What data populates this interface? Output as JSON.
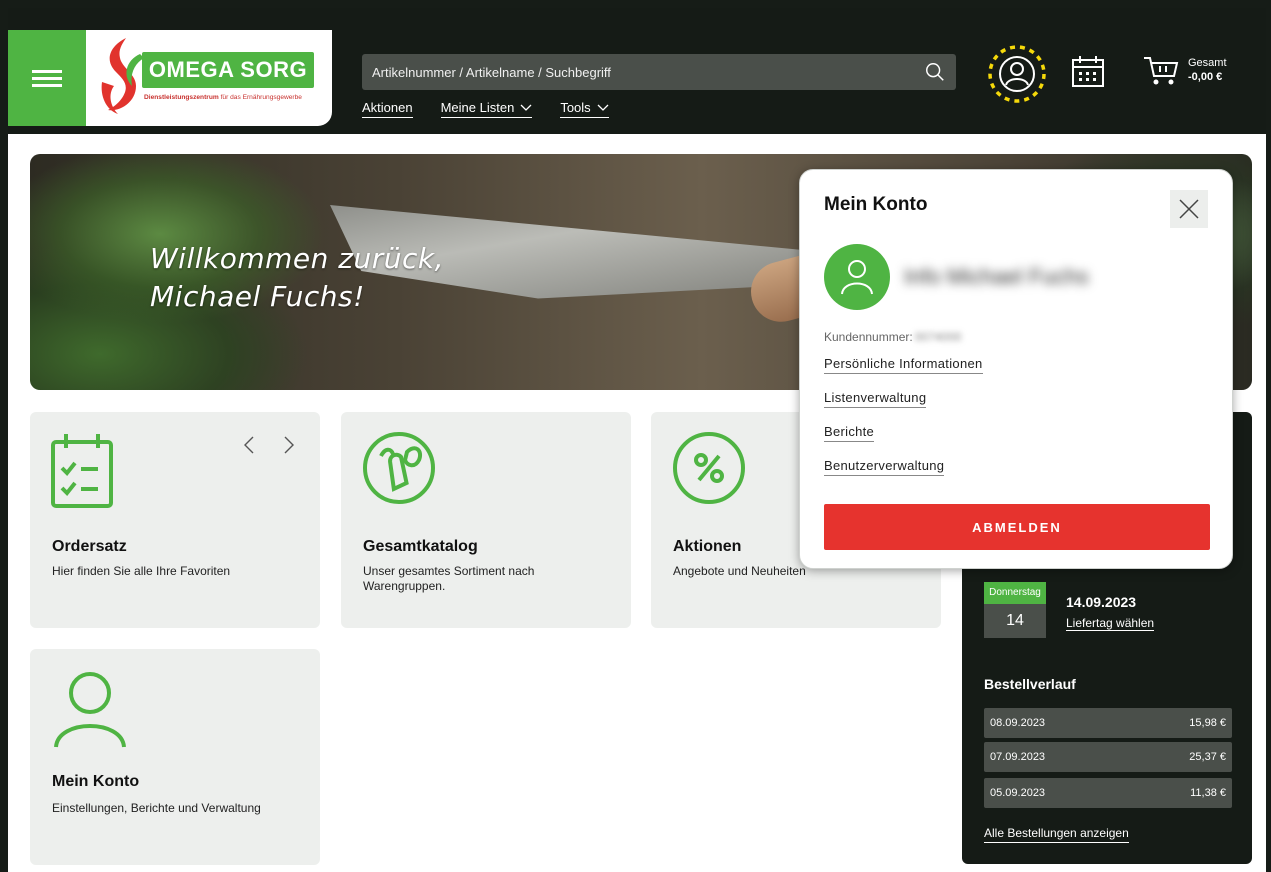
{
  "header": {
    "brand_name": "OMEGA SORG",
    "brand_tagline_bold": "Dienstleistungszentrum",
    "brand_tagline_rest": " für das Ernährungsgewerbe",
    "search_placeholder": "Artikelnummer / Artikelname / Suchbegriff",
    "nav": [
      "Aktionen",
      "Meine Listen",
      "Tools"
    ],
    "cart_label": "Gesamt",
    "cart_amount": "-0,00 €"
  },
  "hero": {
    "line1": "Willkommen zurück,",
    "line2": "Michael Fuchs!"
  },
  "tiles": [
    {
      "title": "Ordersatz",
      "desc": "Hier finden Sie alle Ihre Favoriten"
    },
    {
      "title": "Gesamtkatalog",
      "desc": "Unser gesamtes Sortiment nach Warengruppen."
    },
    {
      "title": "Aktionen",
      "desc": "Angebote und Neuheiten"
    },
    {
      "title": "Mein Konto",
      "desc": "Einstellungen, Berichte und Verwaltung"
    }
  ],
  "delivery": {
    "weekday": "Donnerstag",
    "day": "14",
    "date": "14.09.2023",
    "choose_link": "Liefertag wählen"
  },
  "history": {
    "title": "Bestellverlauf",
    "rows": [
      {
        "date": "08.09.2023",
        "value": "15,98 €"
      },
      {
        "date": "07.09.2023",
        "value": "25,37 €"
      },
      {
        "date": "05.09.2023",
        "value": "11,38 €"
      }
    ],
    "all_link": "Alle Bestellungen anzeigen"
  },
  "popup": {
    "title": "Mein Konto",
    "name_redacted": "Info Michael Fuchs",
    "customer_label": "Kundennummer:",
    "customer_redacted": "0074000",
    "links": [
      "Persönliche Informationen",
      "Listenverwaltung",
      "Berichte",
      "Benutzerverwaltung"
    ],
    "logout": "ABMELDEN"
  },
  "colors": {
    "brand_green": "#4fb443",
    "header_dark": "#151b16",
    "logout_red": "#e6332e",
    "highlight_yellow": "#f5d90a"
  }
}
